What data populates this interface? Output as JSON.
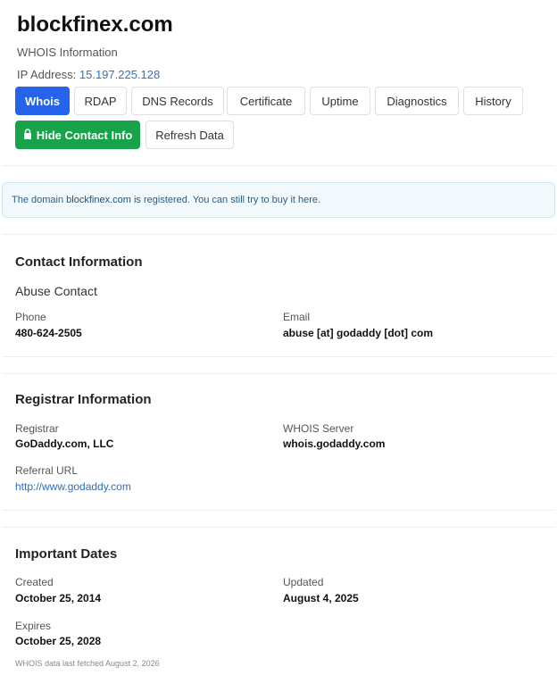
{
  "header": {
    "domain": "blockfinex.com",
    "subtitle": "WHOIS Information",
    "ip_label": "IP Address:",
    "ip_value": "15.197.225.128"
  },
  "tabs": [
    {
      "label": "Whois",
      "active": true
    },
    {
      "label": "RDAP"
    },
    {
      "label": "DNS Records"
    },
    {
      "label": "Certificate"
    },
    {
      "label": "Uptime"
    },
    {
      "label": "Diagnostics"
    },
    {
      "label": "History"
    }
  ],
  "actions": {
    "hide_contact": "Hide Contact Info",
    "refresh": "Refresh Data"
  },
  "alert": {
    "prefix": "The domain",
    "domain": "blockfinex.com",
    "middle": "is registered. You can still try to buy it",
    "link": "here",
    "suffix": "."
  },
  "contact": {
    "title": "Contact Information",
    "subheading": "Abuse Contact",
    "phone_label": "Phone",
    "phone_value": "480-624-2505",
    "email_label": "Email",
    "email_value": "abuse [at] godaddy [dot] com"
  },
  "registrar": {
    "title": "Registrar Information",
    "registrar_label": "Registrar",
    "registrar_value": "GoDaddy.com, LLC",
    "whois_label": "WHOIS Server",
    "whois_value": "whois.godaddy.com",
    "referral_label": "Referral URL",
    "referral_value": "http://www.godaddy.com"
  },
  "dates": {
    "title": "Important Dates",
    "created_label": "Created",
    "created_value": "October 25, 2014",
    "updated_label": "Updated",
    "updated_value": "August 4, 2025",
    "expires_label": "Expires",
    "expires_value": "October 25, 2028"
  },
  "footer": "WHOIS data last fetched August 2, 2026",
  "colors": {
    "primary": "#2563eb",
    "success": "#16a34a",
    "link": "#2f6db5"
  }
}
